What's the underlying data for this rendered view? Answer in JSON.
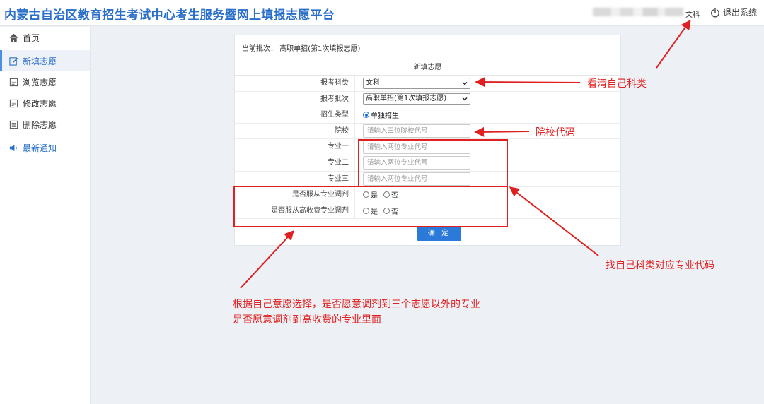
{
  "header": {
    "title": "内蒙古自治区教育招生考试中心考生服务暨网上填报志愿平台",
    "subject": "文科",
    "logout_label": "退出系统"
  },
  "sidebar": {
    "items": [
      {
        "label": "首页",
        "icon": "home-icon"
      },
      {
        "label": "新填志愿",
        "icon": "edit-icon",
        "active": true
      },
      {
        "label": "浏览志愿",
        "icon": "list-icon"
      },
      {
        "label": "修改志愿",
        "icon": "edit-list-icon"
      },
      {
        "label": "删除志愿",
        "icon": "delete-list-icon"
      },
      {
        "label": "最新通知",
        "icon": "speaker-icon"
      }
    ]
  },
  "panel": {
    "batch_label": "当前批次：",
    "batch_value": "高职单招(第1次填报志愿)",
    "form_title": "新填志愿",
    "subject_label": "报考科类",
    "subject_value": "文科",
    "batch_field_label": "报考批次",
    "batch_field_value": "高职单招(第1次填报志愿)",
    "type_label": "招生类型",
    "type_option": "单独招生",
    "school_label": "院校",
    "school_placeholder": "请输入三位院校代号",
    "major1_label": "专业一",
    "major2_label": "专业二",
    "major3_label": "专业三",
    "major_placeholder": "请输入两位专业代号",
    "adjust_label": "是否服从专业调剂",
    "highfee_label": "是否服从高收费专业调剂",
    "yes": "是",
    "no": "否",
    "submit_label": "确 定"
  },
  "annotations": {
    "subject_note": "看清自己科类",
    "school_note": "院校代码",
    "major_note": "找自己科类对应专业代码",
    "adjust_note_line1": "根据自己意愿选择，是否愿意调剂到三个志愿以外的专业",
    "adjust_note_line2": "是否愿意调剂到高收费的专业里面",
    "color": "#e02020"
  },
  "colors": {
    "brand": "#2a6fc9",
    "button": "#2b79d8",
    "background": "#edf0f4"
  }
}
